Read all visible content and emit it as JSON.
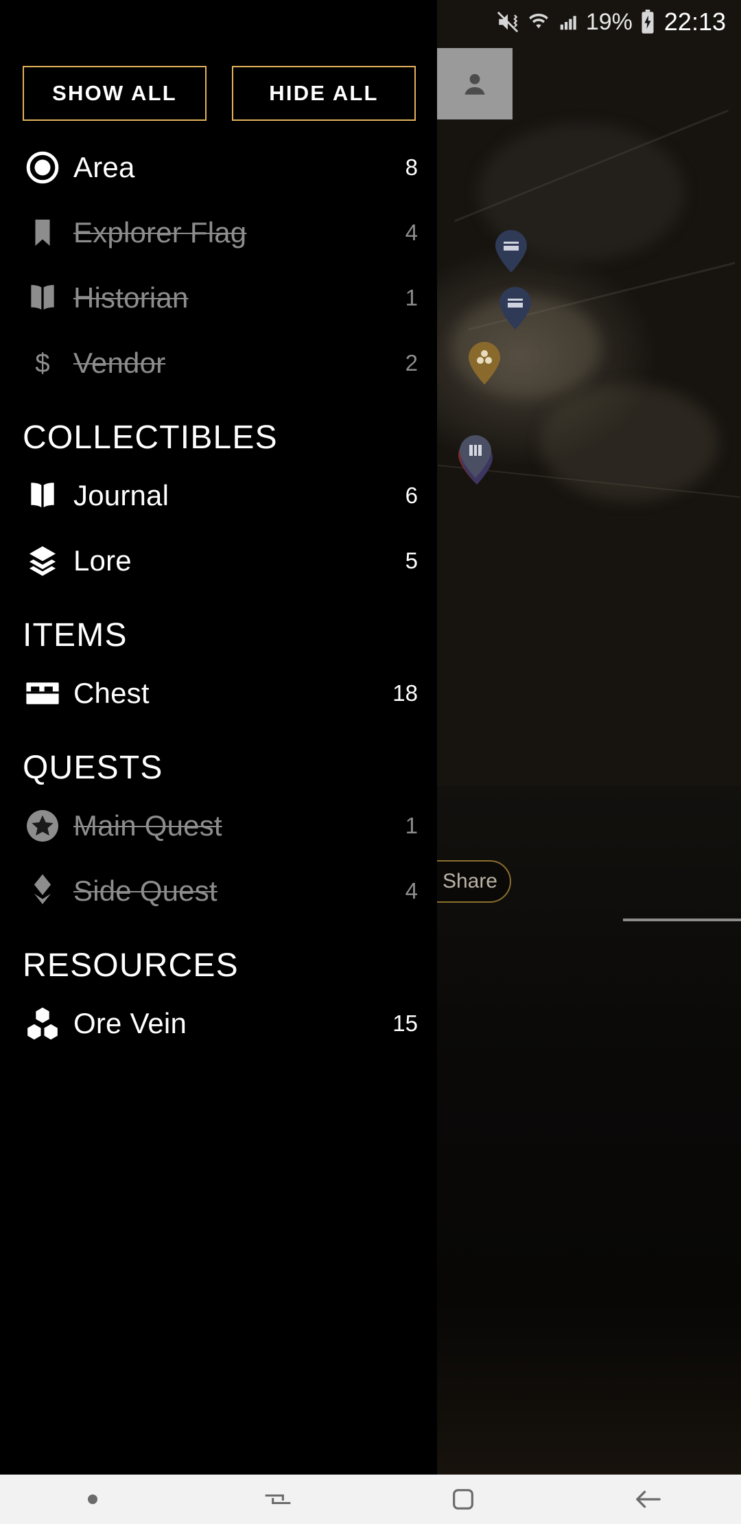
{
  "status_bar": {
    "battery_percent": "19%",
    "time": "22:13",
    "icons": [
      "mute-vibrate-icon",
      "wifi-icon",
      "cellular-signal-icon",
      "battery-charging-icon"
    ]
  },
  "drawer": {
    "buttons": {
      "show_all": "SHOW ALL",
      "hide_all": "HIDE ALL"
    },
    "accent_color": "#e5b35c",
    "disabled_color": "#8d8d8d",
    "active_color": "#ffffff",
    "groups": [
      {
        "header": "",
        "items": [
          {
            "label": "Area",
            "count": "8",
            "icon": "circle-dot-icon",
            "enabled": true
          },
          {
            "label": "Explorer Flag",
            "count": "4",
            "icon": "bookmark-icon",
            "enabled": false
          },
          {
            "label": "Historian",
            "count": "1",
            "icon": "book-open-icon",
            "enabled": false
          },
          {
            "label": "Vendor",
            "count": "2",
            "icon": "dollar-sign-icon",
            "enabled": false
          }
        ]
      },
      {
        "header": "COLLECTIBLES",
        "items": [
          {
            "label": "Journal",
            "count": "6",
            "icon": "book-open-icon",
            "enabled": true
          },
          {
            "label": "Lore",
            "count": "5",
            "icon": "layers-icon",
            "enabled": true
          }
        ]
      },
      {
        "header": "ITEMS",
        "items": [
          {
            "label": "Chest",
            "count": "18",
            "icon": "chest-icon",
            "enabled": true
          }
        ]
      },
      {
        "header": "QUESTS",
        "items": [
          {
            "label": "Main Quest",
            "count": "1",
            "icon": "star-circle-icon",
            "enabled": false
          },
          {
            "label": "Side Quest",
            "count": "4",
            "icon": "diamond-chevron-icon",
            "enabled": false
          }
        ]
      },
      {
        "header": "RESOURCES",
        "items": [
          {
            "label": "Ore Vein",
            "count": "15",
            "icon": "ore-hexagons-icon",
            "enabled": true
          }
        ]
      }
    ]
  },
  "map": {
    "share_button_label": "Share",
    "avatar_icon": "account-circle-icon"
  },
  "navbar": {
    "items": [
      {
        "icon": "dot-indicator-icon",
        "label": ""
      },
      {
        "icon": "recents-icon",
        "label": ""
      },
      {
        "icon": "home-square-icon",
        "label": ""
      },
      {
        "icon": "back-arrow-icon",
        "label": ""
      }
    ]
  }
}
